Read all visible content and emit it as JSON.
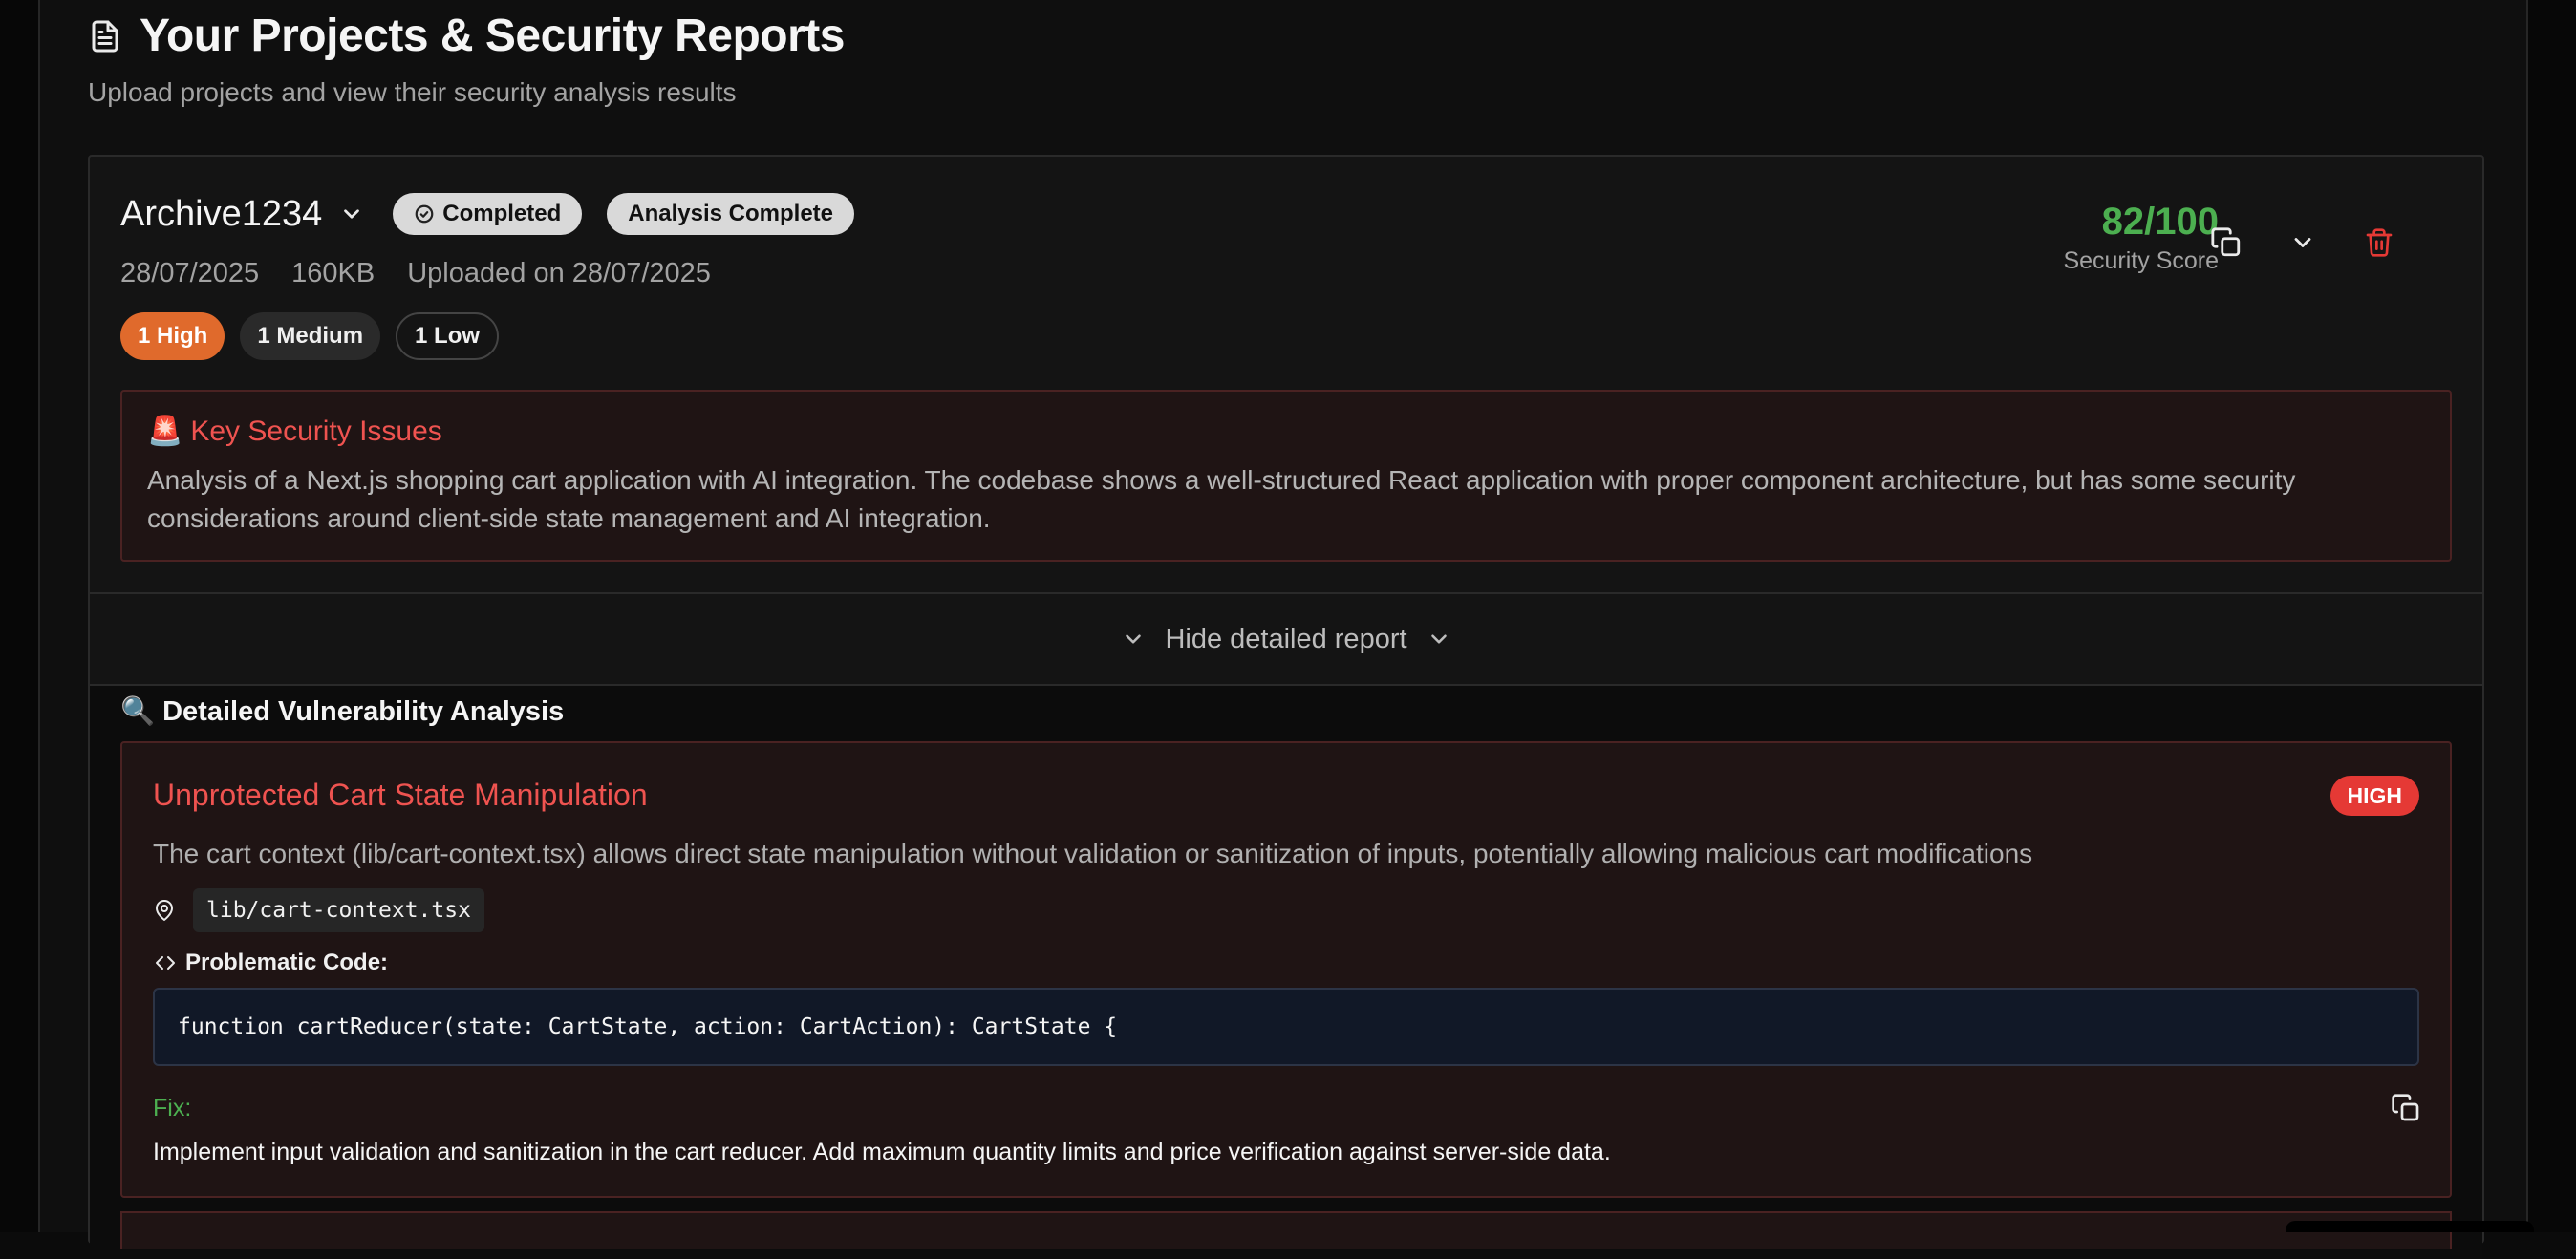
{
  "header": {
    "title": "Your Projects & Security Reports",
    "subtitle": "Upload projects and view their security analysis results",
    "icon": "document-icon"
  },
  "project": {
    "name": "Archive1234",
    "status_badge": "Completed",
    "analysis_badge": "Analysis Complete",
    "date": "28/07/2025",
    "size": "160KB",
    "uploaded": "Uploaded on 28/07/2025",
    "severity_counts": {
      "high": "1 High",
      "medium": "1 Medium",
      "low": "1 Low"
    },
    "score": "82/100",
    "score_label": "Security Score",
    "colors": {
      "score": "#4caf50",
      "high": "#e06a2c",
      "danger": "#ef5350"
    }
  },
  "key_issues": {
    "emoji": "🚨",
    "title": "Key Security Issues",
    "text": "Analysis of a Next.js shopping cart application with AI integration. The codebase shows a well-structured React application with proper component architecture, but has some security considerations around client-side state management and AI integration."
  },
  "toggle": {
    "label": "Hide detailed report"
  },
  "detail": {
    "emoji": "🔍",
    "title": "Detailed Vulnerability Analysis",
    "vulnerability": {
      "title": "Unprotected Cart State Manipulation",
      "severity": "HIGH",
      "description": "The cart context (lib/cart-context.tsx) allows direct state manipulation without validation or sanitization of inputs, potentially allowing malicious cart modifications",
      "file": "lib/cart-context.tsx",
      "code_label": "Problematic Code:",
      "code": "function cartReducer(state: CartState, action: CartAction): CartState {",
      "fix_label": "Fix:",
      "fix_text": "Implement input validation and sanitization in the cart reducer. Add maximum quantity limits and price verification against server-side data."
    }
  }
}
